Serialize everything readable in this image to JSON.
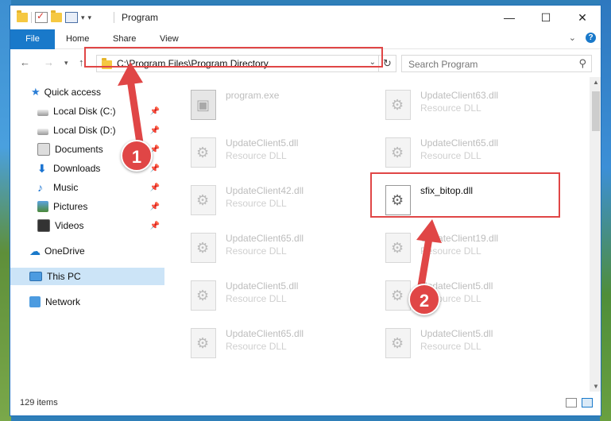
{
  "window": {
    "title": "Program",
    "caption_buttons": [
      "minimize-icon",
      "maximize-icon",
      "close-icon"
    ]
  },
  "ribbon": {
    "tabs": [
      {
        "label": "File"
      },
      {
        "label": "Home"
      },
      {
        "label": "Share"
      },
      {
        "label": "View"
      }
    ]
  },
  "address": {
    "path": "C:\\Program Files\\Program Directory"
  },
  "search": {
    "placeholder": "Search Program"
  },
  "nav": {
    "quick_access": "Quick access",
    "items": [
      {
        "label": "Local Disk (C:)"
      },
      {
        "label": "Local Disk (D:)"
      },
      {
        "label": "Documents"
      },
      {
        "label": "Downloads"
      },
      {
        "label": "Music"
      },
      {
        "label": "Pictures"
      },
      {
        "label": "Videos"
      }
    ],
    "onedrive": "OneDrive",
    "this_pc": "This PC",
    "network": "Network"
  },
  "files": [
    {
      "name": "program.exe",
      "type": ""
    },
    {
      "name": "UpdateClient63.dll",
      "type": "Resource DLL"
    },
    {
      "name": "UpdateClient5.dll",
      "type": "Resource DLL"
    },
    {
      "name": "UpdateClient65.dll",
      "type": "Resource DLL"
    },
    {
      "name": "UpdateClient42.dll",
      "type": "Resource DLL"
    },
    {
      "name": "sfix_bitop.dll",
      "type": ""
    },
    {
      "name": "UpdateClient65.dll",
      "type": "Resource DLL"
    },
    {
      "name": "UpdateClient19.dll",
      "type": "Resource DLL"
    },
    {
      "name": "UpdateClient5.dll",
      "type": "Resource DLL"
    },
    {
      "name": "UpdateClient5.dll",
      "type": "Resource DLL"
    },
    {
      "name": "UpdateClient65.dll",
      "type": "Resource DLL"
    },
    {
      "name": "UpdateClient5.dll",
      "type": "Resource DLL"
    }
  ],
  "status": {
    "item_count": "129 items"
  },
  "annotations": {
    "step1": "1",
    "step2": "2",
    "highlight_color": "#e04646"
  }
}
